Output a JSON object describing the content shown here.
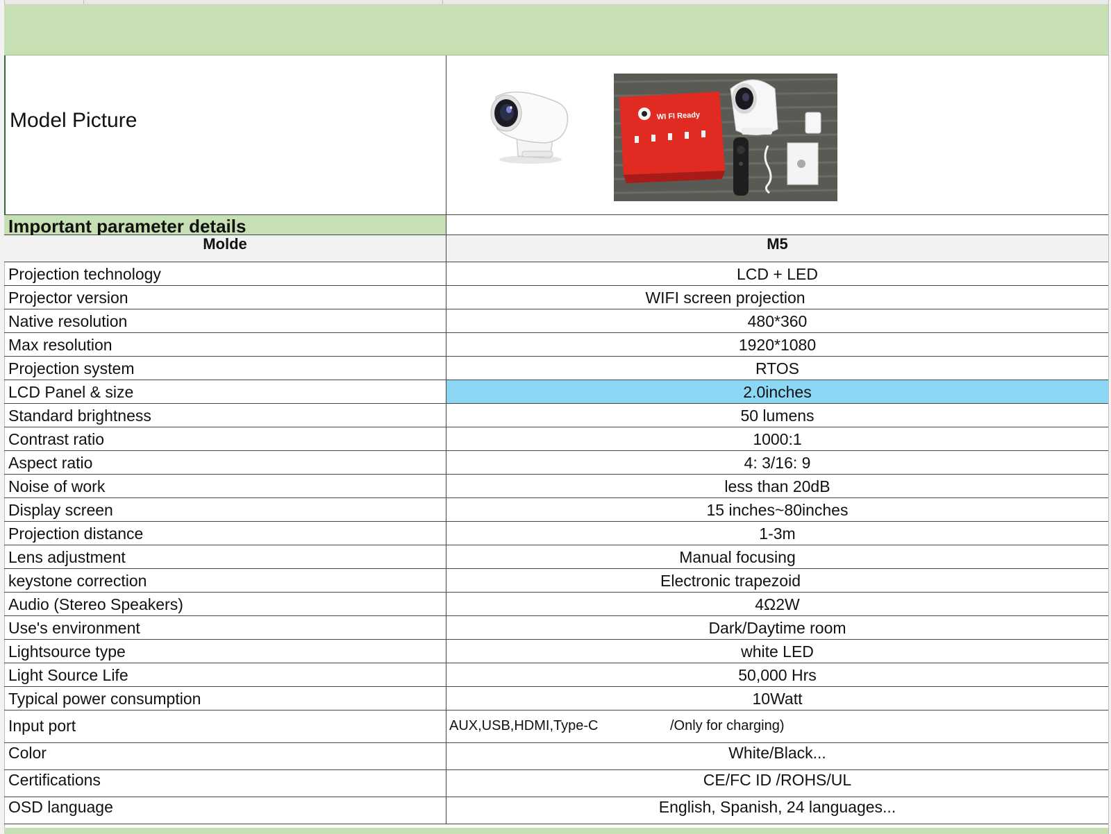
{
  "picture_section": {
    "label": "Model Picture",
    "images": [
      {
        "name": "projector-photo",
        "description": "white projector"
      },
      {
        "name": "kit-photo",
        "description": "red box with projector, remote, cable, manual"
      }
    ],
    "box_text": "WI FI Ready"
  },
  "section_heading": "Important parameter details",
  "table": {
    "header": {
      "label": "Molde",
      "value": "M5"
    },
    "rows": [
      {
        "label": "Projection technology",
        "value": "LCD + LED"
      },
      {
        "label": "Projector version",
        "value": "WIFI screen projection"
      },
      {
        "label": "Native resolution",
        "value": "480*360"
      },
      {
        "label": "Max resolution",
        "value": "1920*1080"
      },
      {
        "label": "Projection system",
        "value": "RTOS"
      },
      {
        "label": "LCD Panel & size",
        "value": "2.0inches"
      },
      {
        "label": "Standard brightness",
        "value": "50 lumens"
      },
      {
        "label": "Contrast ratio",
        "value": "1000:1"
      },
      {
        "label": "Aspect ratio",
        "value": "4: 3/16: 9"
      },
      {
        "label": "Noise of work",
        "value": "less than 20dB"
      },
      {
        "label": "Display screen",
        "value": "15 inches~80inches"
      },
      {
        "label": "Projection distance",
        "value": "1-3m"
      },
      {
        "label": "Lens adjustment",
        "value": "Manual focusing"
      },
      {
        "label": "keystone correction",
        "value": "Electronic trapezoid"
      },
      {
        "label": "Audio (Stereo Speakers)",
        "value": "4Ω2W"
      },
      {
        "label": "Use's environment",
        "value": "Dark/Daytime room"
      },
      {
        "label": "Lightsource type",
        "value": "white LED"
      },
      {
        "label": "Light Source Life",
        "value": "50,000 Hrs"
      },
      {
        "label": "Typical power consumption",
        "value": "10Watt"
      },
      {
        "label": "Input port",
        "value": "AUX,USB,HDMI,Type-C",
        "note": "/Only for charging)"
      },
      {
        "label": "Color",
        "value": "White/Black..."
      },
      {
        "label": "Certifications",
        "value": "CE/FC ID /ROHS/UL"
      },
      {
        "label": "OSD language",
        "value": "English, Spanish,  24 languages..."
      }
    ]
  },
  "colors": {
    "header_green": "#c6e0b4",
    "highlight_blue": "#8cd8f4",
    "header_gray": "#f2f2f2"
  }
}
